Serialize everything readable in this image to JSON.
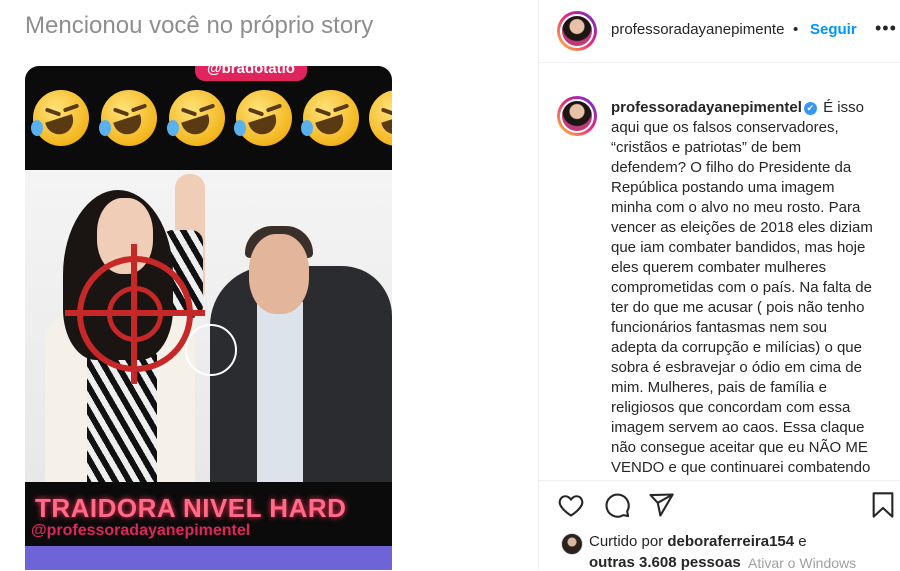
{
  "left_panel": {
    "title": "Mencionou você no próprio story",
    "story": {
      "top_tag": "@bradotatio",
      "caption": "TRAIDORA NIVEL HARD",
      "handle": "@professoradayanepimentel"
    }
  },
  "post": {
    "header": {
      "username": "professoradayanepimente",
      "dot": "•",
      "follow_label": "Seguir",
      "more_label": "•••"
    },
    "caption": {
      "username": "professoradayanepimentel",
      "verified_mark": "✔",
      "text": "É isso aqui que os falsos conservadores, “cristãos e patriotas” de bem defendem? O filho do Presidente da República postando uma imagem minha com o alvo no meu rosto. Para vencer as eleições de 2018 eles diziam que iam combater bandidos, mas hoje eles querem combater mulheres comprometidas com o país. Na falta de ter do que me acusar ( pois não tenho funcionários fantasmas nem sou adepta da corrupção e milícias) o que sobra é esbravejar o ódio em cima de mim. Mulheres, pais de família e religiosos que concordam com essa imagem servem ao caos. Essa claque não consegue aceitar que eu NÃO ME VENDO e que continuarei combatendo"
    },
    "actions": {
      "icons": [
        "heart-icon",
        "comment-icon",
        "share-icon",
        "bookmark-icon"
      ]
    },
    "likes": {
      "prefix": "Curtido por",
      "user": "deboraferreira154",
      "suffix": "e",
      "others": "outras 3.608 pessoas"
    },
    "watermark": "Ativar o Windows"
  }
}
